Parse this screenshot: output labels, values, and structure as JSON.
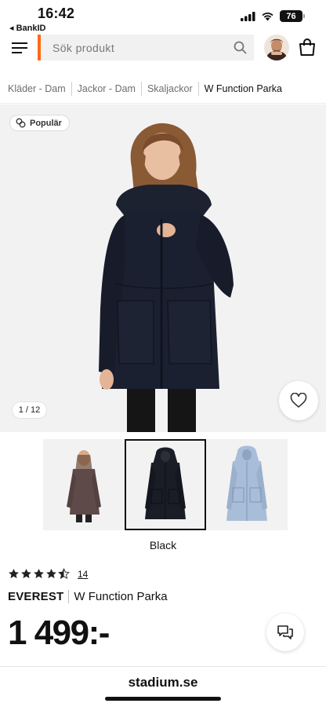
{
  "status_bar": {
    "time": "16:42",
    "back_app": "◂ BankID",
    "battery": "76"
  },
  "header": {
    "search_placeholder": "Sök produkt",
    "accent_color": "#ff6a13"
  },
  "breadcrumb": [
    {
      "label": "Kläder - Dam"
    },
    {
      "label": "Jackor - Dam"
    },
    {
      "label": "Skaljackor"
    },
    {
      "label": "W Function Parka"
    }
  ],
  "gallery": {
    "badge": "Populär",
    "counter": "1 / 12"
  },
  "thumbnails": [
    {
      "color_name": "brown",
      "color": "#5e4a48"
    },
    {
      "color_name": "black",
      "color": "#1a1d26",
      "selected": true
    },
    {
      "color_name": "light-blue",
      "color": "#a8bdd8"
    }
  ],
  "selected_color": "Black",
  "product": {
    "rating": 4.5,
    "rating_max": 5,
    "review_count": "14",
    "brand": "EVEREST",
    "name": "W Function Parka",
    "price": "1 499:-"
  },
  "browser": {
    "url": "stadium.se"
  }
}
